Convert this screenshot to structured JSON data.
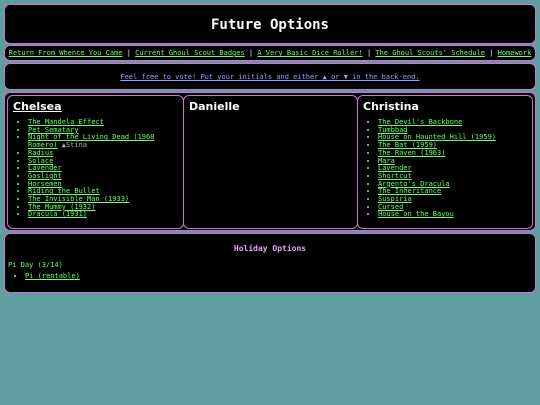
{
  "header": {
    "title": "Future Options"
  },
  "nav": {
    "links": [
      "Return From Whence You Came",
      "Current Ghoul Scout Badges",
      "A Very Basic Dice Roller!",
      "The Ghoul Scouts' Schedule",
      "Homework"
    ],
    "separator": "|"
  },
  "notice": {
    "text": "Feel free to vote! Put your initials and either ▲ or ▼ in the back-end."
  },
  "columns": [
    {
      "name": "Chelsea",
      "items": [
        {
          "title": "The Mandela Effect"
        },
        {
          "title": "Pet Sematary"
        },
        {
          "title": "Night of the Living Dead (1968 Romero)",
          "vote": "▲Stina"
        },
        {
          "title": "Radius"
        },
        {
          "title": "Solace"
        },
        {
          "title": "Lavender"
        },
        {
          "title": "Gaslight"
        },
        {
          "title": "Horsemen"
        },
        {
          "title": "Riding the Bullet"
        },
        {
          "title": "The Invisible Man (1933)"
        },
        {
          "title": "The Mummy (1932)"
        },
        {
          "title": "Dracula (1931)"
        }
      ]
    },
    {
      "name": "Danielle",
      "items": []
    },
    {
      "name": "Christina",
      "items": [
        {
          "title": "The Devil's Backbone"
        },
        {
          "title": "Tumbbad"
        },
        {
          "title": "House on Haunted Hill (1959)"
        },
        {
          "title": "The Bat (1959)"
        },
        {
          "title": "The Raven (1963)"
        },
        {
          "title": "Mara"
        },
        {
          "title": "Lavender"
        },
        {
          "title": "Shortcut"
        },
        {
          "title": "Argento's Dracula"
        },
        {
          "title": "The Inheritance"
        },
        {
          "title": "Suspiria"
        },
        {
          "title": "Cursed"
        },
        {
          "title": "House on the Bayou"
        }
      ]
    }
  ],
  "holiday": {
    "title": "Holiday Options",
    "day": "Pi Day (3/14)",
    "items": [
      "Pi (rentable)"
    ]
  },
  "colors": {
    "background": "#5f9ea0",
    "panel": "#000000",
    "border": "#d070d0",
    "link": "#66ff66",
    "notice": "#8fa0ff",
    "holiday_title": "#e8a0ff"
  }
}
